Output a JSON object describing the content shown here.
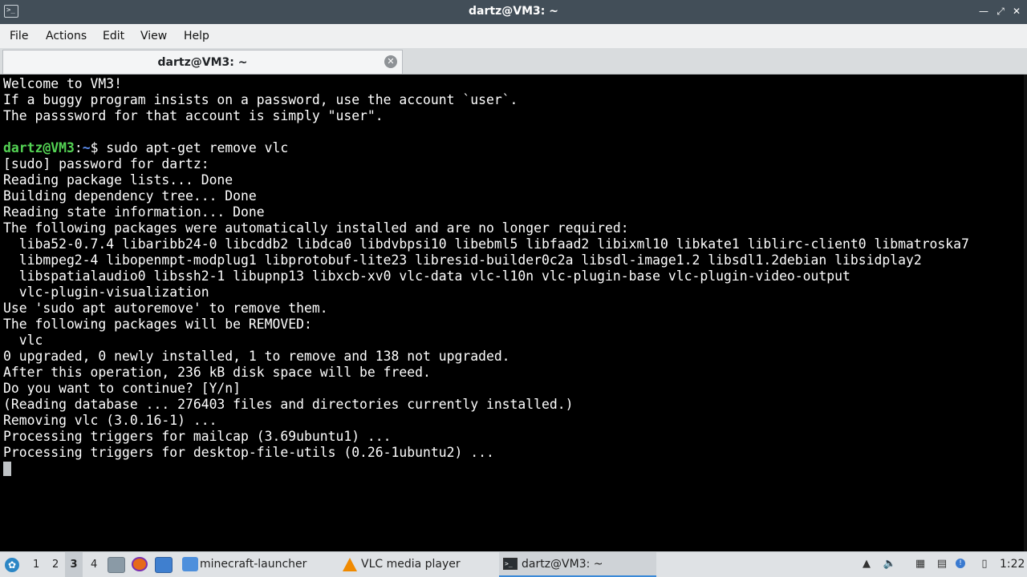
{
  "window": {
    "title": "dartz@VM3: ~",
    "app_icon": "terminal-icon",
    "controls": [
      "minimize-icon",
      "restore-icon",
      "close-icon"
    ]
  },
  "menu": {
    "items": [
      "File",
      "Actions",
      "Edit",
      "View",
      "Help"
    ]
  },
  "tab": {
    "label": "dartz@VM3: ~",
    "close_icon": "close-tab-icon"
  },
  "terminal": {
    "before_prompt": "Welcome to VM3!\nIf a buggy program insists on a password, use the account `user`.\nThe passsword for that account is simply \"user\".\n\n",
    "prompt_user": "dartz@VM3",
    "prompt_sep": ":",
    "prompt_path": "~",
    "command": "$ sudo apt-get remove vlc",
    "after_prompt": "[sudo] password for dartz:\nReading package lists... Done\nBuilding dependency tree... Done\nReading state information... Done\nThe following packages were automatically installed and are no longer required:\n  liba52-0.7.4 libaribb24-0 libcddb2 libdca0 libdvbpsi10 libebml5 libfaad2 libixml10 libkate1 liblirc-client0 libmatroska7\n  libmpeg2-4 libopenmpt-modplug1 libprotobuf-lite23 libresid-builder0c2a libsdl-image1.2 libsdl1.2debian libsidplay2\n  libspatialaudio0 libssh2-1 libupnp13 libxcb-xv0 vlc-data vlc-l10n vlc-plugin-base vlc-plugin-video-output\n  vlc-plugin-visualization\nUse 'sudo apt autoremove' to remove them.\nThe following packages will be REMOVED:\n  vlc\n0 upgraded, 0 newly installed, 1 to remove and 138 not upgraded.\nAfter this operation, 236 kB disk space will be freed.\nDo you want to continue? [Y/n]\n(Reading database ... 276403 files and directories currently installed.)\nRemoving vlc (3.0.16-1) ...\nProcessing triggers for mailcap (3.69ubuntu1) ...\nProcessing triggers for desktop-file-utils (0.26-1ubuntu2) ..."
  },
  "taskbar": {
    "start_icon": "lubuntu-start-icon",
    "workspaces": [
      "1",
      "2",
      "3",
      "4"
    ],
    "active_workspace": "3",
    "quicklaunch": [
      "file-manager-icon",
      "firefox-icon",
      "desktop-icon"
    ],
    "tasks": [
      {
        "label": "minecraft-launcher",
        "icon": "folder-icon"
      },
      {
        "label": "VLC media player",
        "icon": "vlc-cone-icon"
      },
      {
        "label": "dartz@VM3: ~",
        "icon": "terminal-icon"
      }
    ],
    "tray": [
      "update-notifier-icon",
      "volume-icon",
      "clipboard-icon",
      "network-icon",
      "info-icon",
      "battery-icon"
    ],
    "clock": "1:22"
  },
  "colors": {
    "titlebar": "#424e58",
    "prompt_user": "#54d454",
    "prompt_path": "#5b8df0",
    "terminal_bg": "#000000"
  }
}
